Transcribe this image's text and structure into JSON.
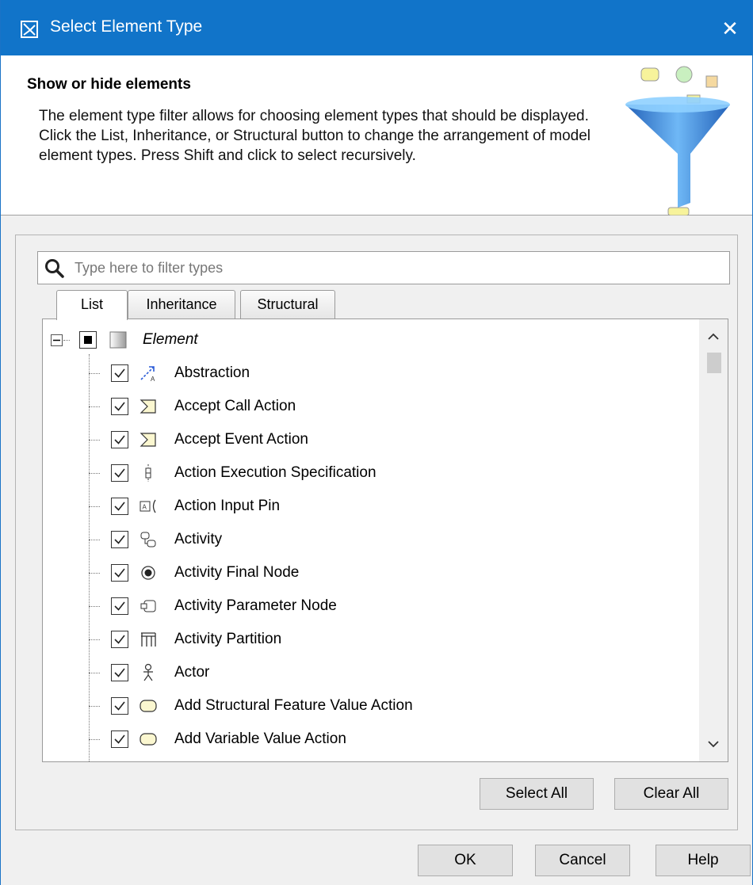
{
  "window": {
    "title": "Select Element Type",
    "close_glyph": "✕"
  },
  "header": {
    "title": "Show or hide elements",
    "description": "The element type filter allows for choosing element types that should be displayed. Click the List, Inheritance, or Structural button to change the arrangement of model element types. Press Shift and click to select recursively."
  },
  "search": {
    "placeholder": "Type here to filter types",
    "value": ""
  },
  "tabs": [
    {
      "label": "List",
      "active": true
    },
    {
      "label": "Inheritance",
      "active": false
    },
    {
      "label": "Structural",
      "active": false
    }
  ],
  "tree": {
    "root": {
      "label": "Element",
      "expanded": true,
      "checked": "partial"
    },
    "items": [
      {
        "label": "Abstraction",
        "icon": "abstraction-icon",
        "checked": true
      },
      {
        "label": "Accept Call Action",
        "icon": "accept-call-action-icon",
        "checked": true
      },
      {
        "label": "Accept Event Action",
        "icon": "accept-event-action-icon",
        "checked": true
      },
      {
        "label": "Action Execution Specification",
        "icon": "action-execution-specification-icon",
        "checked": true
      },
      {
        "label": "Action Input Pin",
        "icon": "action-input-pin-icon",
        "checked": true
      },
      {
        "label": "Activity",
        "icon": "activity-icon",
        "checked": true
      },
      {
        "label": "Activity Final Node",
        "icon": "activity-final-node-icon",
        "checked": true
      },
      {
        "label": "Activity Parameter Node",
        "icon": "activity-parameter-node-icon",
        "checked": true
      },
      {
        "label": "Activity Partition",
        "icon": "activity-partition-icon",
        "checked": true
      },
      {
        "label": "Actor",
        "icon": "actor-icon",
        "checked": true
      },
      {
        "label": "Add Structural Feature Value Action",
        "icon": "action-icon",
        "checked": true
      },
      {
        "label": "Add Variable Value Action",
        "icon": "action-icon",
        "checked": true
      }
    ]
  },
  "buttons": {
    "select_all": "Select All",
    "clear_all": "Clear All",
    "ok": "OK",
    "cancel": "Cancel",
    "help": "Help"
  },
  "colors": {
    "titlebar": "#1174c9",
    "dialog_bg": "#f0f0f0"
  }
}
